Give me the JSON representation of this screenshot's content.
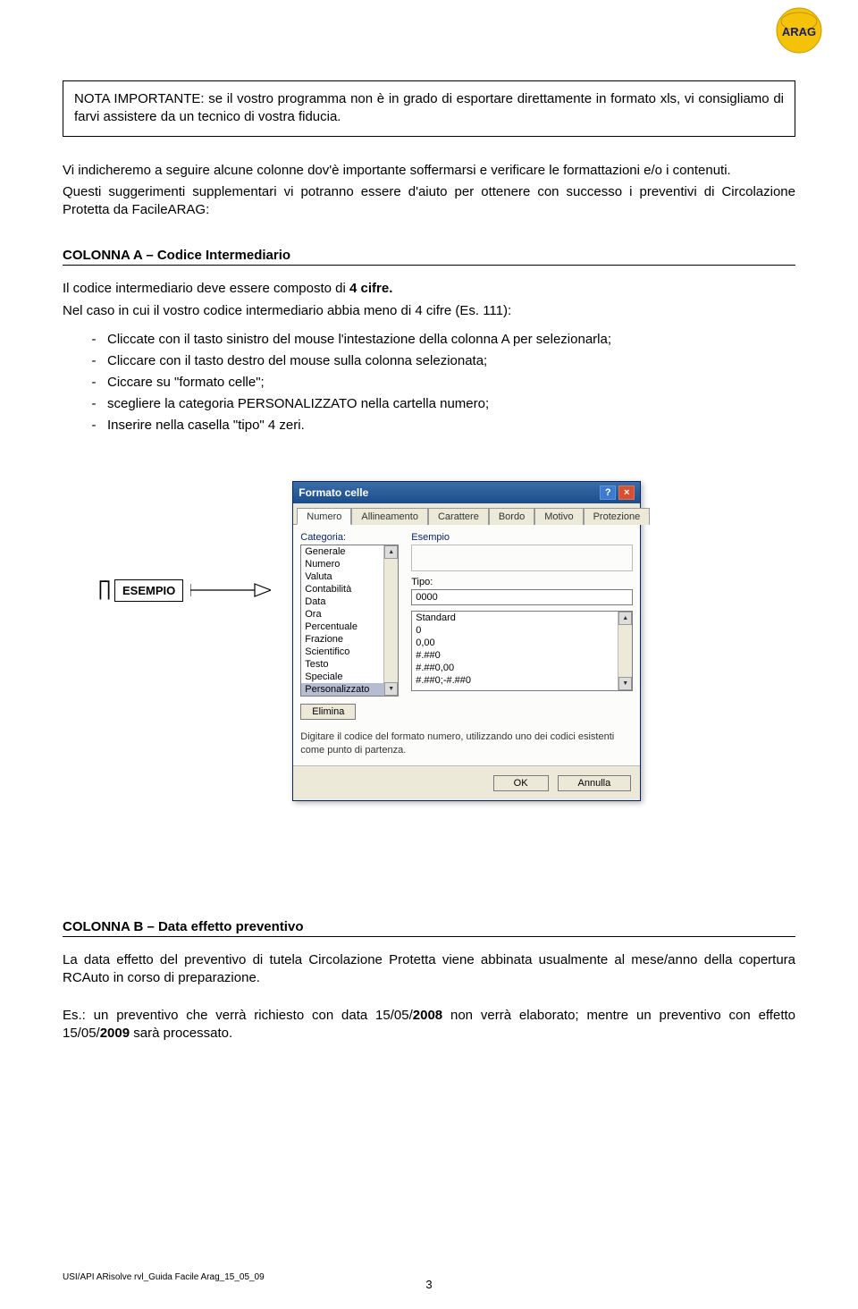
{
  "logo_text": "ARAG",
  "nota": "NOTA IMPORTANTE: se il vostro programma non è in grado di esportare direttamente in formato xls, vi consigliamo di farvi assistere da un tecnico di vostra fiducia.",
  "intro1": "Vi indicheremo a seguire alcune colonne dov'è importante soffermarsi e verificare le formattazioni e/o i contenuti.",
  "intro2": "Questi suggerimenti supplementari vi potranno essere d'aiuto per ottenere con successo i preventivi di Circolazione Protetta da FacileARAG:",
  "sectionA_head": "COLONNA A – Codice Intermediario",
  "sectionA_p1_a": "Il codice intermediario deve essere composto di ",
  "sectionA_p1_b": "4 cifre.",
  "sectionA_p2": "Nel caso in cui il vostro codice intermediario abbia meno di 4 cifre (Es. 111):",
  "bullets": [
    "Cliccate con il tasto sinistro del mouse l'intestazione della colonna A per selezionarla;",
    "Cliccare con il tasto destro del mouse sulla colonna selezionata;",
    "Ciccare su \"formato celle\";",
    "scegliere la categoria PERSONALIZZATO nella cartella numero;",
    "Inserire nella casella \"tipo\" 4 zeri."
  ],
  "esempio_label": "ESEMPIO",
  "dialog": {
    "title": "Formato celle",
    "tabs": [
      "Numero",
      "Allineamento",
      "Carattere",
      "Bordo",
      "Motivo",
      "Protezione"
    ],
    "cat_label": "Categoria:",
    "sample_label": "Esempio",
    "categories": [
      "Generale",
      "Numero",
      "Valuta",
      "Contabilità",
      "Data",
      "Ora",
      "Percentuale",
      "Frazione",
      "Scientifico",
      "Testo",
      "Speciale",
      "Personalizzato"
    ],
    "tipo_label": "Tipo:",
    "tipo_value": "0000",
    "type_list": [
      "Standard",
      "0",
      "0,00",
      "#.##0",
      "#.##0,00",
      "#.##0;-#.##0"
    ],
    "elimina": "Elimina",
    "hint": "Digitare il codice del formato numero, utilizzando uno dei codici esistenti come punto di partenza.",
    "ok": "OK",
    "cancel": "Annulla"
  },
  "sectionB_head": "COLONNA B – Data effetto preventivo",
  "sectionB_p1": "La data effetto del preventivo di tutela Circolazione Protetta viene abbinata usualmente al mese/anno della copertura RCAuto in corso di preparazione.",
  "sectionB_p2_a": "Es.: un preventivo che verrà richiesto con data 15/05/",
  "sectionB_p2_b": "2008",
  "sectionB_p2_c": " non verrà elaborato; mentre un preventivo con effetto 15/05/",
  "sectionB_p2_d": "2009",
  "sectionB_p2_e": " sarà processato.",
  "footer_ref": "USI/API ARisolve rvl_Guida Facile Arag_15_05_09",
  "page_num": "3"
}
